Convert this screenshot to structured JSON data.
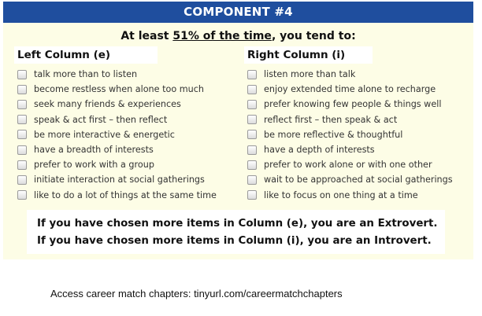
{
  "header": {
    "title": "COMPONENT #4"
  },
  "subtitle": {
    "prefix": "At least ",
    "emphasis": "51% of the time",
    "suffix": ", you tend to:"
  },
  "left_column": {
    "title": "Left Column (e)",
    "items": [
      "talk more than to listen",
      "become restless when alone too much",
      "seek many friends & experiences",
      "speak & act first – then reflect",
      "be more interactive & energetic",
      "have a breadth of interests",
      "prefer to work with a group",
      "initiate interaction at social gatherings",
      "like to do a lot of things at the same time"
    ]
  },
  "right_column": {
    "title": "Right Column (i)",
    "items": [
      "listen more than talk",
      "enjoy extended time alone to recharge",
      "prefer knowing few people & things well",
      "reflect first – then speak & act",
      "be more reflective & thoughtful",
      "have a depth of interests",
      "prefer to work alone or with one other",
      "wait to be approached at social gatherings",
      "like to focus on one thing at a time"
    ]
  },
  "result": {
    "extrovert": "If you have chosen more items in Column (e), you are an Extrovert.",
    "introvert": "If you have chosen more items in Column (i), you are an Introvert."
  },
  "footer": {
    "text": "Access career match chapters: tinyurl.com/careermatchchapters"
  },
  "colors": {
    "header_bg": "#1f4e9e",
    "panel_bg": "#fdfde6"
  }
}
